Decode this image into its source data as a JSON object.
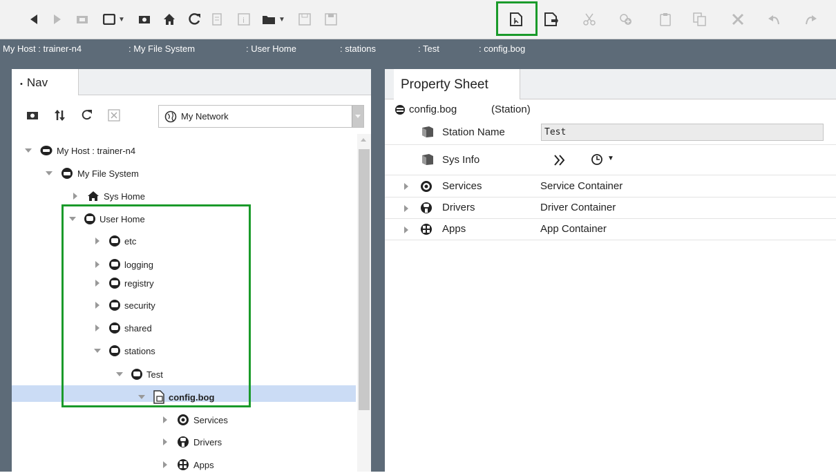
{
  "toolbar": {
    "highlight_color": "#1a9a2a",
    "icons": [
      "back-arrow-icon",
      "forward-arrow-icon",
      "folder-icon",
      "window-icon",
      "capture-icon",
      "home-icon",
      "refresh-icon",
      "doc-icon",
      "info-icon",
      "open-folder-icon",
      "save-icon",
      "save-all-icon",
      "new-station-icon",
      "export-icon",
      "cut-icon",
      "link-icon",
      "paste-icon",
      "duplicate-icon",
      "delete-icon",
      "undo-icon",
      "redo-icon"
    ]
  },
  "breadcrumb": {
    "items": [
      "My Host : trainer-n4",
      ": My File System",
      ": User Home",
      ": stations",
      ": Test",
      ": config.bog"
    ]
  },
  "nav": {
    "tab_label": "Nav",
    "network_select_value": "My Network",
    "tree": [
      {
        "label": "My Host : trainer-n4"
      },
      {
        "label": "My File System"
      },
      {
        "label": "Sys Home"
      },
      {
        "label": "User Home"
      },
      {
        "label": "etc"
      },
      {
        "label": "logging"
      },
      {
        "label": "registry"
      },
      {
        "label": "security"
      },
      {
        "label": "shared"
      },
      {
        "label": "stations"
      },
      {
        "label": "Test"
      },
      {
        "label": "config.bog"
      },
      {
        "label": "Services"
      },
      {
        "label": "Drivers"
      },
      {
        "label": "Apps"
      }
    ]
  },
  "property_sheet": {
    "tab_label": "Property Sheet",
    "root_label": "config.bog",
    "root_type": "(Station)",
    "rows": [
      {
        "name": "Station Name",
        "value": "Test"
      },
      {
        "name": "Sys Info",
        "value": ""
      },
      {
        "name": "Services",
        "value": "Service Container"
      },
      {
        "name": "Drivers",
        "value": "Driver Container"
      },
      {
        "name": "Apps",
        "value": "App Container"
      }
    ]
  },
  "colors": {
    "accent": "#1a9a2a",
    "breadcrumb_bg": "#5d6b78",
    "selection": "#cbdcf5"
  }
}
